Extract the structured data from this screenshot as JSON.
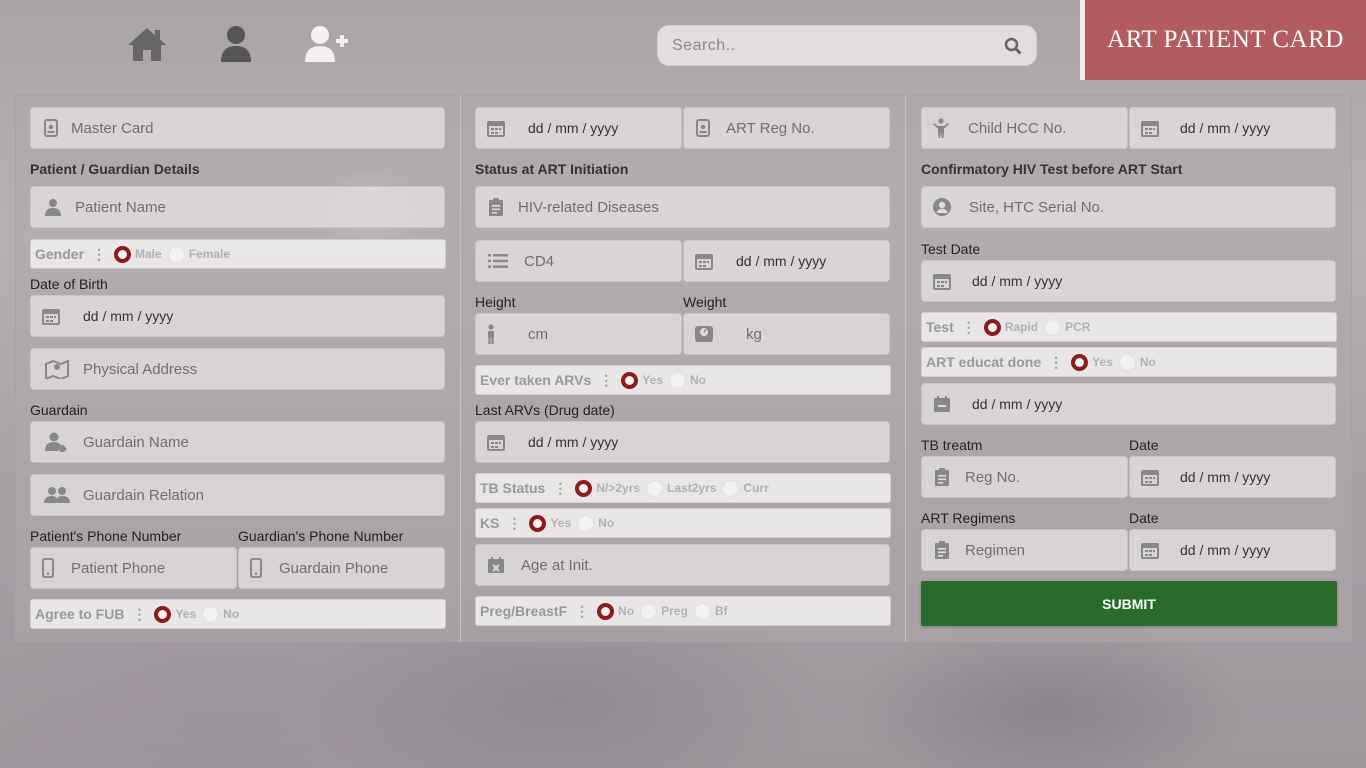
{
  "app": {
    "title": "ART PATIENT CARD"
  },
  "nav": {
    "icons": [
      "home-icon",
      "user-icon",
      "user-plus-icon"
    ]
  },
  "search": {
    "placeholder": "Search.."
  },
  "date_placeholder": "dd / mm / yyyy",
  "col1": {
    "master_card": "Master Card",
    "section_title": "Patient / Guardian Details",
    "patient_name": "Patient Name",
    "gender": {
      "label": "Gender",
      "options": [
        "Male",
        "Female"
      ],
      "selected": "Male"
    },
    "dob_label": "Date of Birth",
    "physical_address": "Physical Address",
    "guardian_label": "Guardain",
    "guardian_name": "Guardain Name",
    "guardian_relation": "Guardain Relation",
    "patient_phone_label": "Patient's Phone Number",
    "guardian_phone_label": "Guardian's Phone Number",
    "patient_phone": "Patient Phone",
    "guardian_phone": "Guardain Phone",
    "agree_fub": {
      "label": "Agree to FUB",
      "options": [
        "Yes",
        "No"
      ],
      "selected": "Yes"
    }
  },
  "col2": {
    "art_reg_no": "ART Reg No.",
    "section_title": "Status at ART Initiation",
    "hiv_diseases": "HIV-related Diseases",
    "cd4": "CD4",
    "height_label": "Height",
    "weight_label": "Weight",
    "height": "cm",
    "weight": "kg",
    "ever_taken_arvs": {
      "label": "Ever taken ARVs",
      "options": [
        "Yes",
        "No"
      ],
      "selected": "Yes"
    },
    "last_arvs_label": "Last ARVs (Drug date)",
    "tb_status": {
      "label": "TB Status",
      "options": [
        "N/>2yrs",
        "Last2yrs",
        "Curr"
      ],
      "selected": "N/>2yrs"
    },
    "ks": {
      "label": "KS",
      "options": [
        "Yes",
        "No"
      ],
      "selected": "Yes"
    },
    "age_at_init": "Age at Init.",
    "preg_breastf": {
      "label": "Preg/BreastF",
      "options": [
        "No",
        "Preg",
        "Bf"
      ],
      "selected": "No"
    }
  },
  "col3": {
    "child_hcc_no": "Child HCC No.",
    "section_title": "Confirmatory HIV Test before ART Start",
    "site_htc": "Site, HTC Serial No.",
    "test_date_label": "Test Date",
    "test": {
      "label": "Test",
      "options": [
        "Rapid",
        "PCR"
      ],
      "selected": "Rapid"
    },
    "art_educat": {
      "label": "ART educat done",
      "options": [
        "Yes",
        "No"
      ],
      "selected": "Yes"
    },
    "tb_treatm_label": "TB treatm",
    "date_label": "Date",
    "reg_no": "Reg No.",
    "art_regimens_label": "ART Regimens",
    "regimen": "Regimen",
    "submit": "SUBMIT"
  },
  "colors": {
    "brand": "#b25c5f",
    "submit": "#2a6b2a",
    "radio_selected": "#8e1b1b"
  }
}
